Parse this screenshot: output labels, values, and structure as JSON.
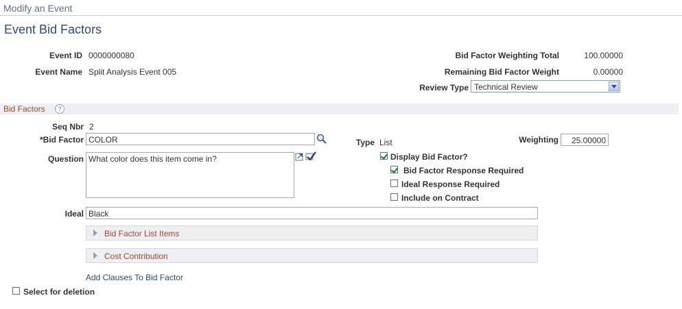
{
  "breadcrumb": "Modify an Event",
  "page_title": "Event Bid Factors",
  "header": {
    "event_id_label": "Event ID",
    "event_id": "0000000080",
    "event_name_label": "Event Name",
    "event_name": "Split Analysis Event 005",
    "weighting_total_label": "Bid Factor Weighting Total",
    "weighting_total": "100.00000",
    "remaining_label": "Remaining Bid Factor Weight",
    "remaining": "0.00000",
    "review_type_label": "Review Type",
    "review_type": "Technical Review"
  },
  "section": {
    "title": "Bid Factors",
    "help": "?"
  },
  "bid_factor": {
    "seq_label": "Seq Nbr",
    "seq": "2",
    "factor_label": "*Bid Factor",
    "factor": "COLOR",
    "type_label": "Type",
    "type": "List",
    "weighting_label": "Weighting",
    "weighting": "25.00000",
    "question_label": "Question",
    "question": "What color does this item come in?",
    "display_label": "Display Bid Factor?",
    "display_checked": true,
    "response_required_label": "Bid Factor Response Required",
    "response_required_checked": true,
    "ideal_required_label": "Ideal Response Required",
    "ideal_required_checked": false,
    "include_contract_label": "Include on Contract",
    "include_contract_checked": false,
    "ideal_label": "Ideal",
    "ideal": "Black",
    "list_items_label": "Bid Factor List Items",
    "cost_label": "Cost Contribution",
    "add_clauses_label": "Add Clauses To Bid Factor",
    "select_delete_label": "Select for deletion",
    "select_delete_checked": false
  },
  "colors": {
    "title": "#2c4a7a",
    "section": "#a0482c",
    "link": "#2c4a7a"
  }
}
